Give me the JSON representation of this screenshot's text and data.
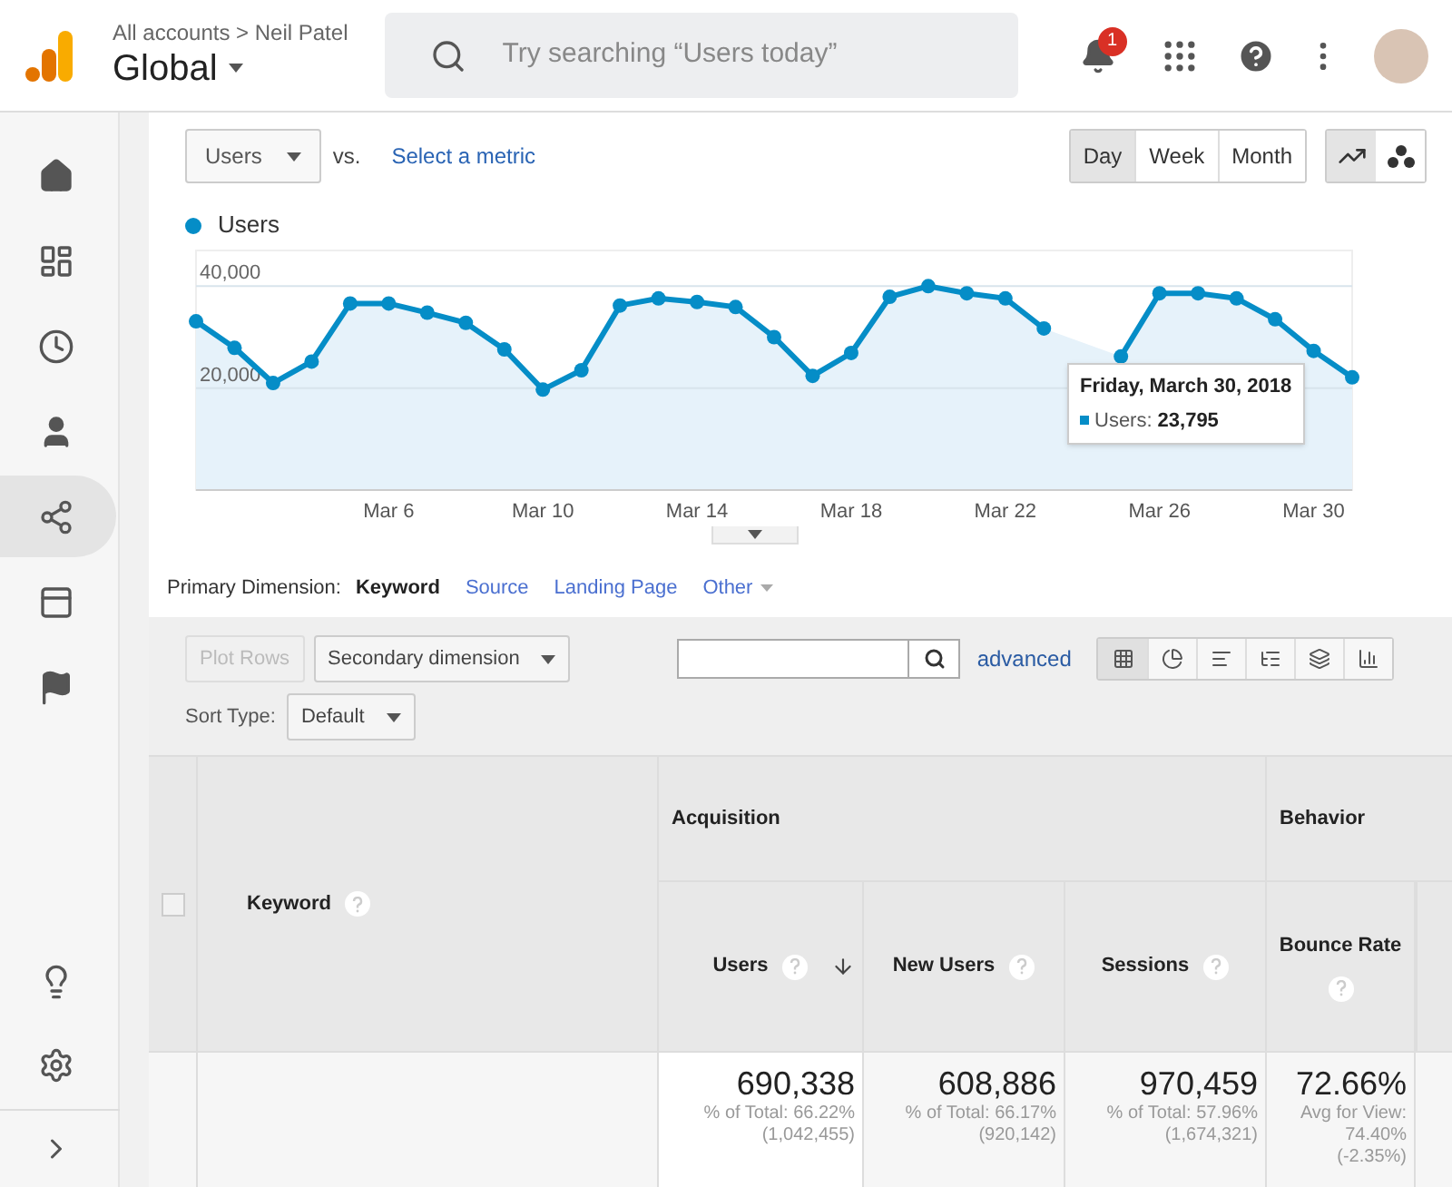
{
  "header": {
    "breadcrumb": "All accounts > Neil Patel",
    "property": "Global",
    "search": {
      "placeholder": "Try searching “Users today”"
    },
    "notification_count": "1"
  },
  "sidebar": {
    "items": [
      {
        "selected": false
      },
      {
        "selected": false
      },
      {
        "selected": false
      },
      {
        "selected": false
      },
      {
        "selected": true
      },
      {
        "selected": false
      },
      {
        "selected": false
      }
    ]
  },
  "chart_toolbar": {
    "metric": "Users",
    "vs": "vs.",
    "compare_link": "Select a metric",
    "periods": [
      {
        "label": "Day",
        "selected": true
      },
      {
        "label": "Week",
        "selected": false
      },
      {
        "label": "Month",
        "selected": false
      }
    ],
    "chart_types": [
      {
        "selected": true
      },
      {
        "selected": false
      }
    ]
  },
  "chart": {
    "tooltip": {
      "title": "Friday, March 30, 2018",
      "label": "Users:",
      "value": "23,795"
    },
    "chart_data": {
      "type": "area",
      "categories": [
        null,
        null,
        null,
        null,
        null,
        "Mar 6",
        null,
        null,
        null,
        "Mar 10",
        null,
        null,
        null,
        "Mar 14",
        null,
        null,
        null,
        "Mar 18",
        null,
        null,
        null,
        "Mar 22",
        null,
        null,
        null,
        "Mar 26",
        null,
        null,
        null,
        "Mar 30",
        null
      ],
      "series": [
        {
          "name": "Users",
          "color": "#058dc7",
          "values": [
            33100,
            27900,
            21000,
            25200,
            36600,
            36600,
            34800,
            32800,
            27600,
            19700,
            23500,
            36200,
            37600,
            36900,
            35900,
            30000,
            22400,
            26900,
            37900,
            40000,
            38600,
            37600,
            31700,
            null,
            26200,
            38600,
            38600,
            37600,
            33500,
            27300,
            22100
          ]
        }
      ],
      "ylim": [
        0,
        47000
      ],
      "yticks": [
        {
          "value": 20000,
          "label": "20,000"
        },
        {
          "value": 40000,
          "label": "40,000"
        }
      ]
    }
  },
  "dimensions": {
    "label": "Primary Dimension:",
    "items": [
      {
        "label": "Keyword",
        "selected": true,
        "kind": "tab"
      },
      {
        "label": "Source",
        "selected": false,
        "kind": "tab"
      },
      {
        "label": "Landing Page",
        "selected": false,
        "kind": "tab"
      },
      {
        "label": "Other",
        "selected": false,
        "kind": "menu"
      }
    ]
  },
  "table_controls": {
    "plot_rows": {
      "label": "Plot Rows",
      "disabled": true
    },
    "secondary_dimension": "Secondary dimension",
    "advanced_link": "advanced",
    "views": [
      {
        "selected": true
      },
      {
        "selected": false
      },
      {
        "selected": false
      },
      {
        "selected": false
      },
      {
        "selected": false
      },
      {
        "selected": false
      }
    ],
    "sort_label": "Sort Type:",
    "sort_value": "Default"
  },
  "table": {
    "select_all": {
      "checked": false
    },
    "dimension_column": "Keyword",
    "groups": [
      "Acquisition",
      "Behavior"
    ],
    "columns": [
      {
        "label": "Users",
        "sorted": true
      },
      {
        "label": "New Users",
        "sorted": false
      },
      {
        "label": "Sessions",
        "sorted": false
      },
      {
        "label": "Bounce Rate",
        "sorted": false
      }
    ],
    "totals": [
      {
        "value": "690,338",
        "lines": [
          "% of Total: 66.22%",
          "(1,042,455)"
        ]
      },
      {
        "value": "608,886",
        "lines": [
          "% of Total: 66.17%",
          "(920,142)"
        ]
      },
      {
        "value": "970,459",
        "lines": [
          "% of Total: 57.96%",
          "(1,674,321)"
        ]
      },
      {
        "value": "72.66%",
        "lines": [
          "Avg for View:",
          "74.40%",
          "(-2.35%)"
        ]
      }
    ]
  }
}
